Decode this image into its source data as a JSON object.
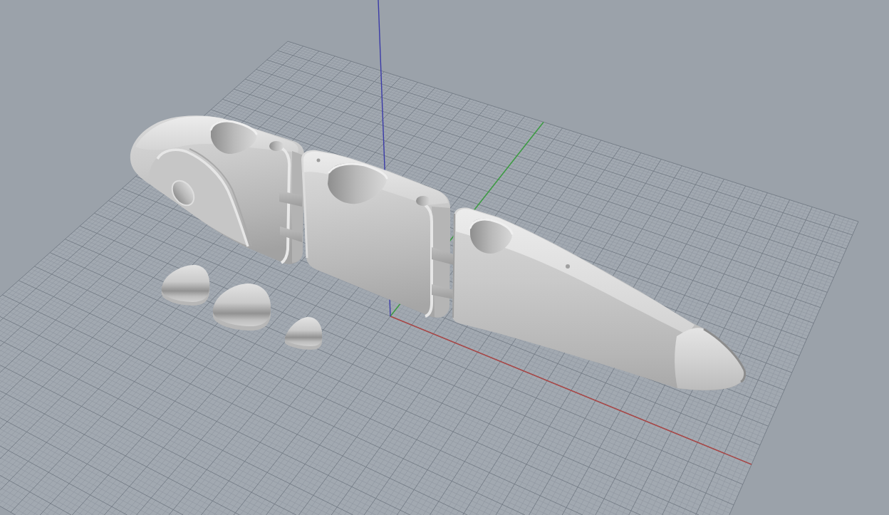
{
  "viewport": {
    "grid": true,
    "world_axes": true
  }
}
